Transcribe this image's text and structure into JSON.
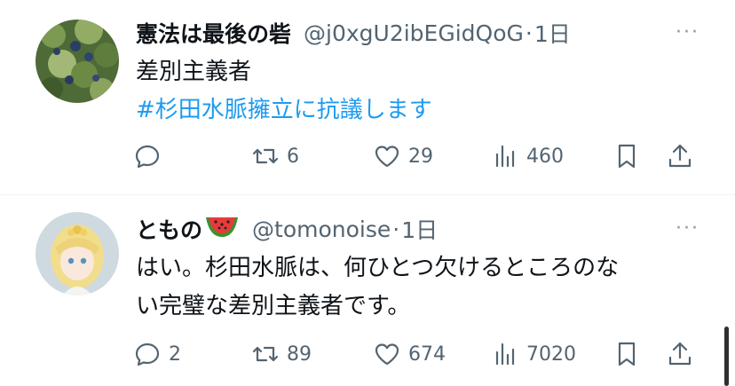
{
  "tweets": [
    {
      "name": "憲法は最後の砦",
      "handle": "@j0xgU2ibEGidQoG",
      "dot": "·",
      "time": "1日",
      "more": "···",
      "text": "差別主義者",
      "hashtag": "#杉田水脈擁立に抗議します",
      "reply_count": "",
      "retweet_count": "6",
      "like_count": "29",
      "view_count": "460"
    },
    {
      "name": "ともの",
      "name_emoji": "watermelon-emoji",
      "handle": "@tomonoise",
      "dot": "·",
      "time": "1日",
      "more": "···",
      "text_line1": "はい。杉田水脈は、何ひとつ欠けるところのな",
      "text_line2": "い完璧な差別主義者です。",
      "reply_count": "2",
      "retweet_count": "89",
      "like_count": "674",
      "view_count": "7020"
    }
  ],
  "colors": {
    "text": "#0f1419",
    "secondary": "#536471",
    "link": "#1d9bf0",
    "divider": "#eff3f4"
  },
  "icons": [
    "reply-icon",
    "retweet-icon",
    "like-icon",
    "views-icon",
    "bookmark-icon",
    "share-icon"
  ]
}
